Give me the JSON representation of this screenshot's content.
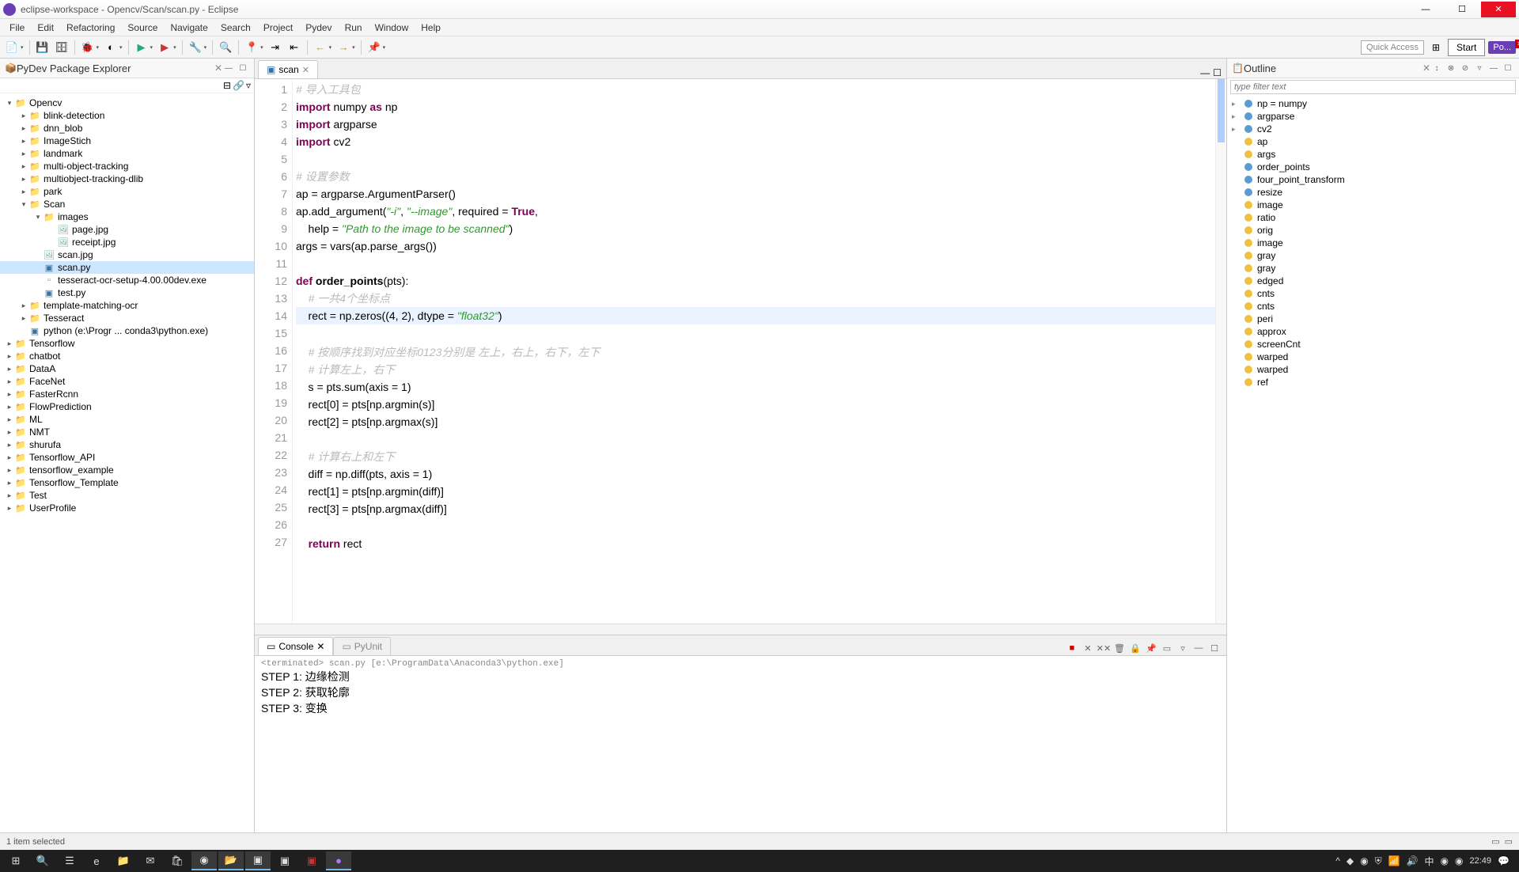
{
  "window": {
    "title": "eclipse-workspace - Opencv/Scan/scan.py - Eclipse"
  },
  "menu": [
    "File",
    "Edit",
    "Refactoring",
    "Source",
    "Navigate",
    "Search",
    "Project",
    "Pydev",
    "Run",
    "Window",
    "Help"
  ],
  "top_right": {
    "quick_access": "Quick Access",
    "start": "Start",
    "perspective": "Po..."
  },
  "explorer": {
    "title": "PyDev Package Explorer",
    "tree": [
      {
        "depth": 0,
        "exp": "▾",
        "icon": "folder",
        "label": "Opencv"
      },
      {
        "depth": 1,
        "exp": "▸",
        "icon": "folder",
        "label": "blink-detection"
      },
      {
        "depth": 1,
        "exp": "▸",
        "icon": "folder",
        "label": "dnn_blob"
      },
      {
        "depth": 1,
        "exp": "▸",
        "icon": "folder",
        "label": "ImageStich"
      },
      {
        "depth": 1,
        "exp": "▸",
        "icon": "folder",
        "label": "landmark"
      },
      {
        "depth": 1,
        "exp": "▸",
        "icon": "folder",
        "label": "multi-object-tracking"
      },
      {
        "depth": 1,
        "exp": "▸",
        "icon": "folder",
        "label": "multiobject-tracking-dlib"
      },
      {
        "depth": 1,
        "exp": "▸",
        "icon": "folder",
        "label": "park"
      },
      {
        "depth": 1,
        "exp": "▾",
        "icon": "folder",
        "label": "Scan"
      },
      {
        "depth": 2,
        "exp": "▾",
        "icon": "folder",
        "label": "images"
      },
      {
        "depth": 3,
        "exp": "",
        "icon": "img",
        "label": "page.jpg"
      },
      {
        "depth": 3,
        "exp": "",
        "icon": "img",
        "label": "receipt.jpg"
      },
      {
        "depth": 2,
        "exp": "",
        "icon": "img",
        "label": "scan.jpg"
      },
      {
        "depth": 2,
        "exp": "",
        "icon": "py",
        "label": "scan.py",
        "selected": true
      },
      {
        "depth": 2,
        "exp": "",
        "icon": "file",
        "label": "tesseract-ocr-setup-4.00.00dev.exe"
      },
      {
        "depth": 2,
        "exp": "",
        "icon": "py",
        "label": "test.py"
      },
      {
        "depth": 1,
        "exp": "▸",
        "icon": "folder",
        "label": "template-matching-ocr"
      },
      {
        "depth": 1,
        "exp": "▸",
        "icon": "folder",
        "label": "Tesseract"
      },
      {
        "depth": 1,
        "exp": "",
        "icon": "py",
        "label": "python  (e:\\Progr ... conda3\\python.exe)"
      },
      {
        "depth": 0,
        "exp": "▸",
        "icon": "folder",
        "label": "Tensorflow"
      },
      {
        "depth": 0,
        "exp": "▸",
        "icon": "folder",
        "label": "chatbot"
      },
      {
        "depth": 0,
        "exp": "▸",
        "icon": "folder",
        "label": "DataA"
      },
      {
        "depth": 0,
        "exp": "▸",
        "icon": "folder",
        "label": "FaceNet"
      },
      {
        "depth": 0,
        "exp": "▸",
        "icon": "folder",
        "label": "FasterRcnn"
      },
      {
        "depth": 0,
        "exp": "▸",
        "icon": "folder",
        "label": "FlowPrediction"
      },
      {
        "depth": 0,
        "exp": "▸",
        "icon": "folder",
        "label": "ML"
      },
      {
        "depth": 0,
        "exp": "▸",
        "icon": "folder",
        "label": "NMT"
      },
      {
        "depth": 0,
        "exp": "▸",
        "icon": "folder",
        "label": "shurufa"
      },
      {
        "depth": 0,
        "exp": "▸",
        "icon": "folder",
        "label": "Tensorflow_API"
      },
      {
        "depth": 0,
        "exp": "▸",
        "icon": "folder",
        "label": "tensorflow_example"
      },
      {
        "depth": 0,
        "exp": "▸",
        "icon": "folder",
        "label": "Tensorflow_Template"
      },
      {
        "depth": 0,
        "exp": "▸",
        "icon": "folder",
        "label": "Test"
      },
      {
        "depth": 0,
        "exp": "▸",
        "icon": "folder",
        "label": "UserProfile"
      }
    ]
  },
  "editor": {
    "tab": "scan",
    "lines": [
      {
        "n": 1,
        "html": "<span class='cm'># 导入工具包</span>"
      },
      {
        "n": 2,
        "html": "<span class='kw'>import</span> numpy <span class='kw'>as</span> np"
      },
      {
        "n": 3,
        "html": "<span class='kw'>import</span> argparse"
      },
      {
        "n": 4,
        "html": "<span class='kw'>import</span> cv2"
      },
      {
        "n": 5,
        "html": ""
      },
      {
        "n": 6,
        "html": "<span class='cm'># 设置参数</span>"
      },
      {
        "n": 7,
        "html": "ap = argparse.ArgumentParser()"
      },
      {
        "n": 8,
        "html": "ap.add_argument(<span class='st'>\"-i\"</span>, <span class='st'>\"--image\"</span>, required = <span class='kw'>True</span>,"
      },
      {
        "n": 9,
        "html": "    help = <span class='st'>\"Path to the image to be scanned\"</span>)"
      },
      {
        "n": 10,
        "html": "args = vars(ap.parse_args())"
      },
      {
        "n": 11,
        "html": ""
      },
      {
        "n": 12,
        "html": "<span class='kw'>def</span> <span class='fn'>order_points</span>(pts):"
      },
      {
        "n": 13,
        "html": "    <span class='cm'># 一共4个坐标点</span>"
      },
      {
        "n": 14,
        "html": "    rect = np.zeros((4, 2), dtype = <span class='st'>\"float32\"</span>)",
        "hl": true
      },
      {
        "n": 15,
        "html": ""
      },
      {
        "n": 16,
        "html": "    <span class='cm'># 按顺序找到对应坐标0123分别是 左上，右上，右下，左下</span>"
      },
      {
        "n": 17,
        "html": "    <span class='cm'># 计算左上，右下</span>"
      },
      {
        "n": 18,
        "html": "    s = pts.sum(axis = 1)"
      },
      {
        "n": 19,
        "html": "    rect[0] = pts[np.argmin(s)]"
      },
      {
        "n": 20,
        "html": "    rect[2] = pts[np.argmax(s)]"
      },
      {
        "n": 21,
        "html": ""
      },
      {
        "n": 22,
        "html": "    <span class='cm'># 计算右上和左下</span>"
      },
      {
        "n": 23,
        "html": "    diff = np.diff(pts, axis = 1)"
      },
      {
        "n": 24,
        "html": "    rect[1] = pts[np.argmin(diff)]"
      },
      {
        "n": 25,
        "html": "    rect[3] = pts[np.argmax(diff)]"
      },
      {
        "n": 26,
        "html": ""
      },
      {
        "n": 27,
        "html": "    <span class='kw'>return</span> rect"
      }
    ]
  },
  "outline": {
    "title": "Outline",
    "filter_placeholder": "type filter text",
    "items": [
      {
        "label": "np = numpy",
        "arrow": "▸"
      },
      {
        "label": "argparse",
        "arrow": "▸"
      },
      {
        "label": "cv2",
        "arrow": "▸"
      },
      {
        "label": "ap",
        "bullet": "y"
      },
      {
        "label": "args",
        "bullet": "y"
      },
      {
        "label": "order_points",
        "bullet": "b"
      },
      {
        "label": "four_point_transform",
        "bullet": "b"
      },
      {
        "label": "resize",
        "bullet": "b"
      },
      {
        "label": "image",
        "bullet": "y"
      },
      {
        "label": "ratio",
        "bullet": "y"
      },
      {
        "label": "orig",
        "bullet": "y"
      },
      {
        "label": "image",
        "bullet": "y"
      },
      {
        "label": "gray",
        "bullet": "y"
      },
      {
        "label": "gray",
        "bullet": "y"
      },
      {
        "label": "edged",
        "bullet": "y"
      },
      {
        "label": "cnts",
        "bullet": "y"
      },
      {
        "label": "cnts",
        "bullet": "y"
      },
      {
        "label": "peri",
        "bullet": "y"
      },
      {
        "label": "approx",
        "bullet": "y"
      },
      {
        "label": "screenCnt",
        "bullet": "y"
      },
      {
        "label": "warped",
        "bullet": "y"
      },
      {
        "label": "warped",
        "bullet": "y"
      },
      {
        "label": "ref",
        "bullet": "y"
      }
    ]
  },
  "console": {
    "tab": "Console",
    "tab2": "PyUnit",
    "header": "<terminated> scan.py [e:\\ProgramData\\Anaconda3\\python.exe]",
    "lines": [
      "STEP 1: 边缘检测",
      "STEP 2: 获取轮廓",
      "STEP 3: 变换"
    ]
  },
  "statusbar": {
    "text": "1 item selected"
  },
  "taskbar": {
    "time": "22:49",
    "date": ""
  }
}
